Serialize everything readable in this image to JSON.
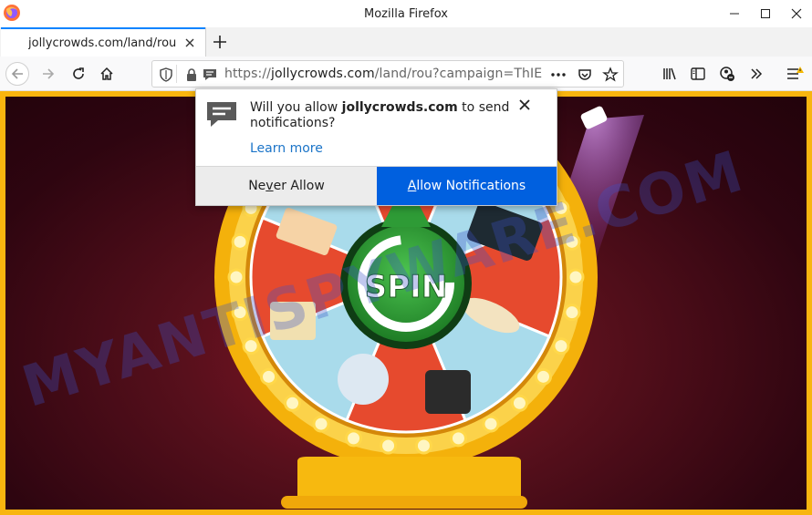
{
  "window": {
    "title": "Mozilla Firefox"
  },
  "tab": {
    "title": "jollycrowds.com/land/rou"
  },
  "urlbar": {
    "scheme": "https://",
    "host": "jollycrowds.com",
    "path": "/land/rou?campaign=ThIE"
  },
  "popup": {
    "msg_before": "Will you allow ",
    "msg_site": "jollycrowds.com",
    "msg_after": " to send notifications?",
    "learn_more": "Learn more",
    "never_pre": "Ne",
    "never_key": "v",
    "never_post": "er Allow",
    "allow_key": "A",
    "allow_post": "llow Notifications"
  },
  "wheel": {
    "center_label": "SPIN"
  },
  "watermark": "MYANTISPYWARE.COM",
  "colors": {
    "accent": "#0060df",
    "frame": "#f8b50f",
    "spin_green": "#2e9b36"
  }
}
